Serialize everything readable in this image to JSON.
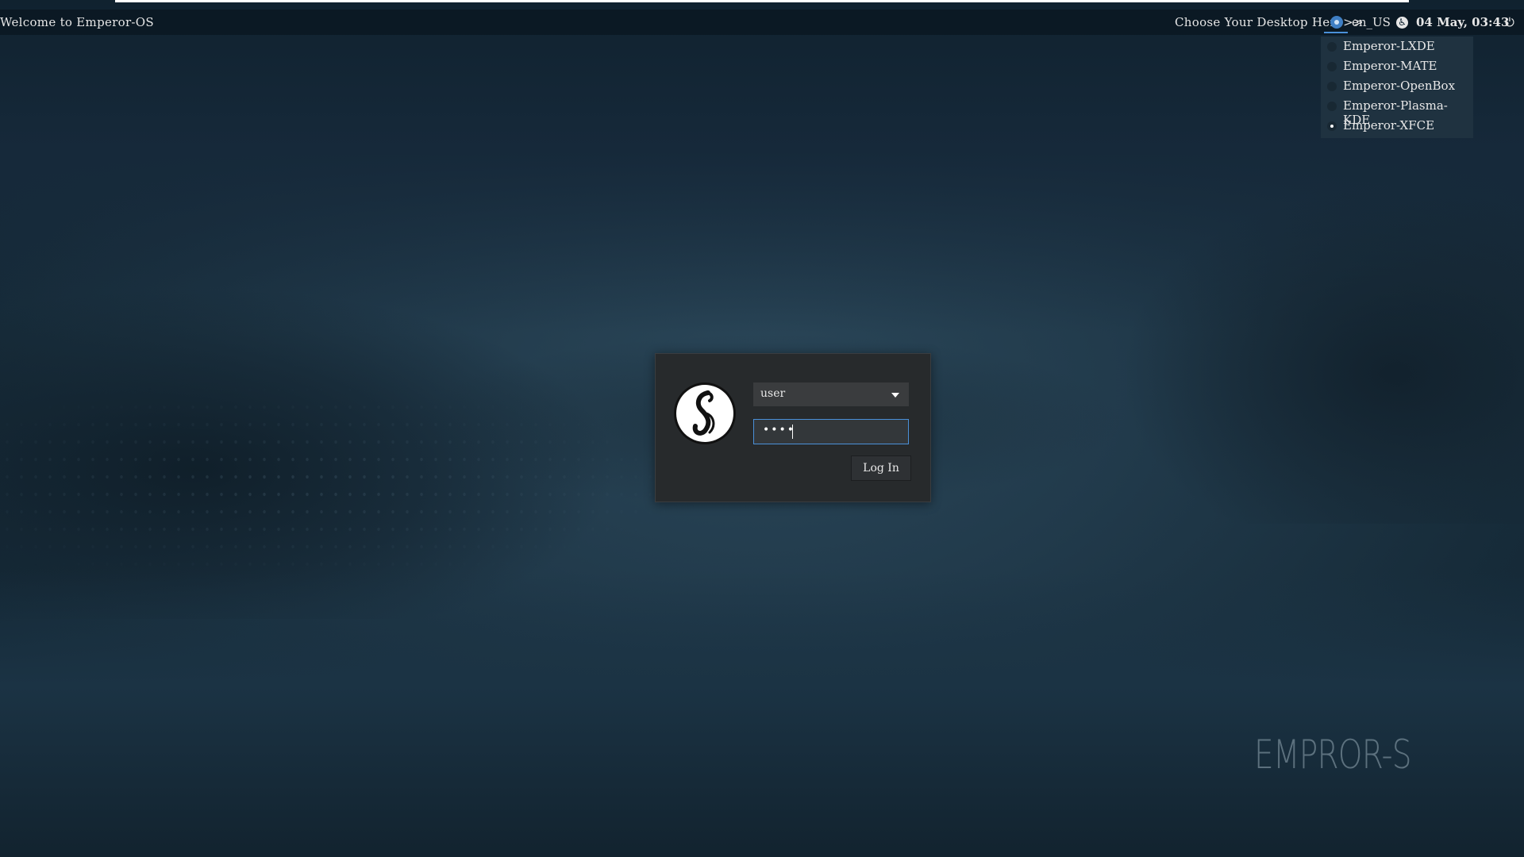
{
  "panel": {
    "welcome": "Welcome to Emperor-OS",
    "choose_desktop": "Choose Your Desktop Here>>",
    "session_icon": "session-icon",
    "language": "en_US",
    "accessibility_icon": "accessibility-icon",
    "datetime": "04 May, 03:43",
    "power_icon": "power-icon"
  },
  "session_menu": {
    "items": [
      {
        "label": "Emperor-LXDE",
        "selected": false
      },
      {
        "label": "Emperor-MATE",
        "selected": false
      },
      {
        "label": "Emperor-OpenBox",
        "selected": false
      },
      {
        "label": "Emperor-Plasma-KDE",
        "selected": false
      },
      {
        "label": "Emperor-XFCE",
        "selected": true
      }
    ]
  },
  "login": {
    "logo_icon": "emperor-os-logo-icon",
    "user": "user",
    "password_mask": "••••",
    "login_label": "Log In"
  },
  "watermark": "EMPROR-S",
  "colors": {
    "accent": "#4a90d9",
    "panel_bg": "#0a1822",
    "dialog_bg": "#272a2c"
  }
}
